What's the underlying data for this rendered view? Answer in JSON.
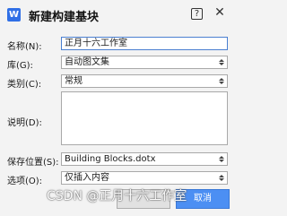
{
  "window": {
    "title": "新建构建基块",
    "app_icon_letter": "W",
    "help_label": "?",
    "close_label": "✕"
  },
  "form": {
    "name": {
      "label": "名称(N):",
      "value": "正月十六工作室"
    },
    "gallery": {
      "label": "库(G):",
      "value": "自动图文集"
    },
    "category": {
      "label": "类别(C):",
      "value": "常规"
    },
    "description": {
      "label": "说明(D):",
      "value": ""
    },
    "save_in": {
      "label": "保存位置(S):",
      "value": "Building Blocks.dotx"
    },
    "options": {
      "label": "选项(O):",
      "value": "仅插入内容"
    }
  },
  "buttons": {
    "ok_label": "",
    "cancel_label": "取消"
  },
  "watermark": "CSDN @正月十六工作室",
  "colors": {
    "accent": "#4c8ff3",
    "app_icon": "#2f6fe6"
  }
}
